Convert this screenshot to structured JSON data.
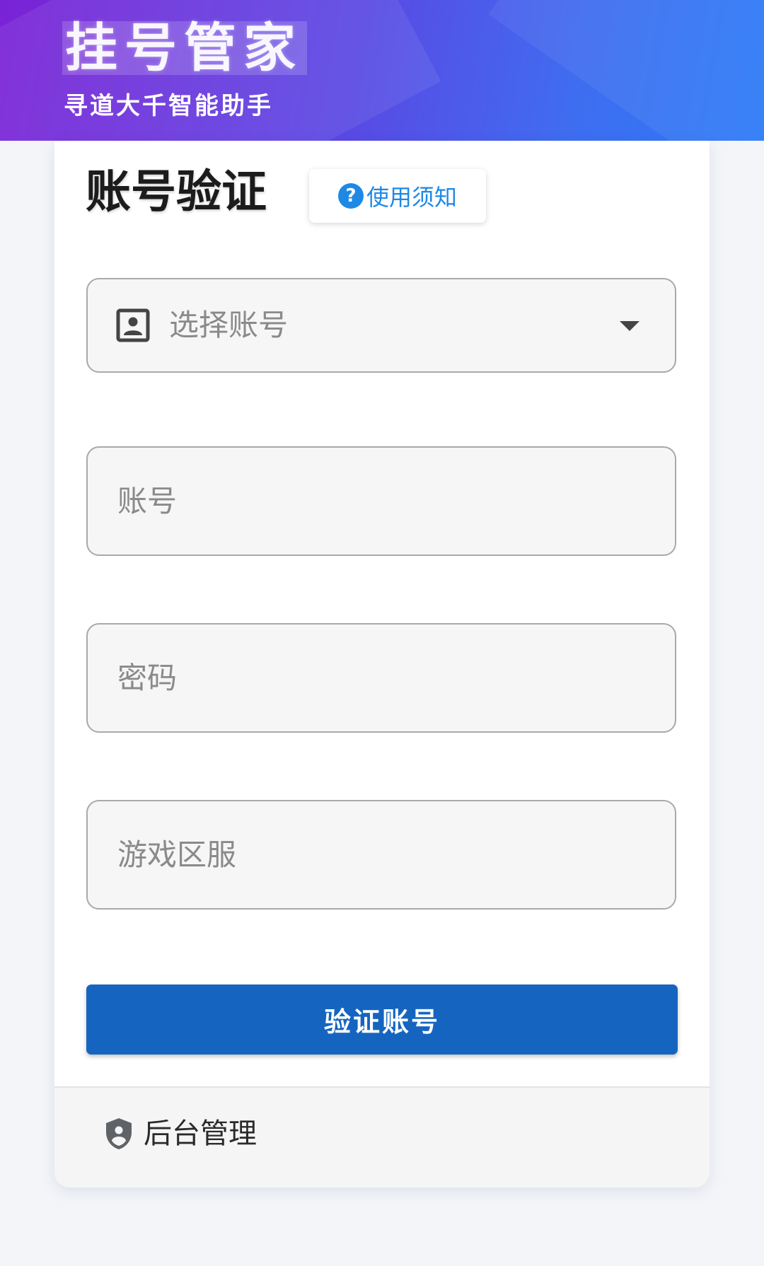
{
  "header": {
    "app_title": "挂号管家",
    "subtitle": "寻道大千智能助手"
  },
  "card": {
    "title": "账号验证",
    "notice_button": "使用须知"
  },
  "form": {
    "select_account_label": "选择账号",
    "account_placeholder": "账号",
    "password_placeholder": "密码",
    "server_placeholder": "游戏区服",
    "submit_label": "验证账号"
  },
  "footer": {
    "admin_label": "后台管理"
  },
  "icons": {
    "help": "help-icon",
    "contact": "contact-icon",
    "dropdown": "chevron-down-icon",
    "shield": "shield-icon"
  },
  "colors": {
    "header_gradient_start": "#7a22d6",
    "header_gradient_end": "#2c7bf7",
    "accent": "#1e88e5",
    "primary_button": "#1565c0",
    "page_background": "#f3f5f9"
  }
}
